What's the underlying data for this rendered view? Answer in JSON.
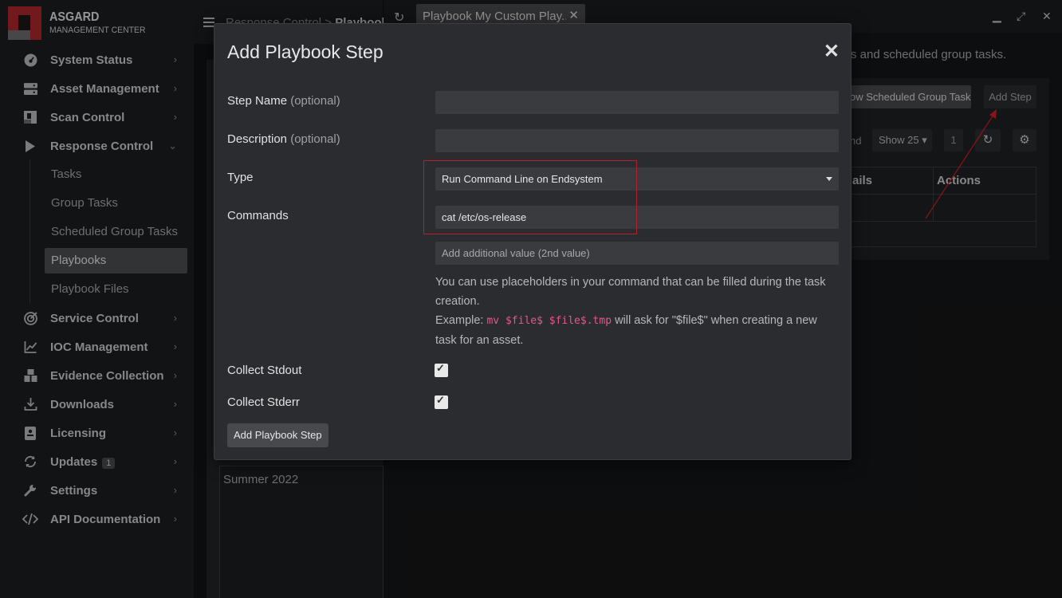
{
  "app": {
    "logo_line1": "ASGARD",
    "logo_line2": "MANAGEMENT CENTER"
  },
  "sidebar": {
    "items": [
      {
        "label": "System Status",
        "icon": "gauge-icon"
      },
      {
        "label": "Asset Management",
        "icon": "server-icon"
      },
      {
        "label": "Scan Control",
        "icon": "scan-icon"
      },
      {
        "label": "Response Control",
        "icon": "play-icon"
      },
      {
        "label": "Service Control",
        "icon": "target-icon"
      },
      {
        "label": "IOC Management",
        "icon": "chart-icon"
      },
      {
        "label": "Evidence Collection",
        "icon": "boxes-icon"
      },
      {
        "label": "Downloads",
        "icon": "download-icon"
      },
      {
        "label": "Licensing",
        "icon": "id-card-icon"
      },
      {
        "label": "Updates",
        "icon": "sync-icon",
        "badge": "1"
      },
      {
        "label": "Settings",
        "icon": "wrench-icon"
      },
      {
        "label": "API Documentation",
        "icon": "code-icon"
      }
    ],
    "response_sub": [
      "Tasks",
      "Group Tasks",
      "Scheduled Group Tasks",
      "Playbooks",
      "Playbook Files"
    ]
  },
  "header": {
    "breadcrumb_parent": "Response Control",
    "breadcrumb_sep": ">",
    "breadcrumb_current": "Playbooks"
  },
  "tab": {
    "label": "Playbook My Custom Play..."
  },
  "background": {
    "description": "s and scheduled group tasks.",
    "btn_sched": "ow Scheduled Group Tasks",
    "btn_add_step": "Add Step",
    "find_label": "nd",
    "show_label": "Show 25",
    "page": "1",
    "col_details": "ails",
    "col_actions": "Actions",
    "playbook_item": "Summer 2022"
  },
  "modal": {
    "title": "Add Playbook Step",
    "step_name_label": "Step Name",
    "step_name_opt": "(optional)",
    "description_label": "Description",
    "description_opt": "(optional)",
    "type_label": "Type",
    "type_value": "Run Command Line on Endsystem",
    "commands_label": "Commands",
    "commands_value": "cat /etc/os-release",
    "additional_placeholder": "Add additional value (2nd value)",
    "help_line1": "You can use placeholders in your command that can be filled during the task creation.",
    "help_example_prefix": "Example:",
    "help_example_code": "mv $file$ $file$.tmp",
    "help_example_suffix": "will ask for \"$file$\" when creating a new task for an asset.",
    "collect_stdout_label": "Collect Stdout",
    "collect_stderr_label": "Collect Stderr",
    "submit_label": "Add Playbook Step"
  },
  "colors": {
    "brand": "#b0272f",
    "highlight": "#b3212b",
    "code": "#e3588a"
  }
}
